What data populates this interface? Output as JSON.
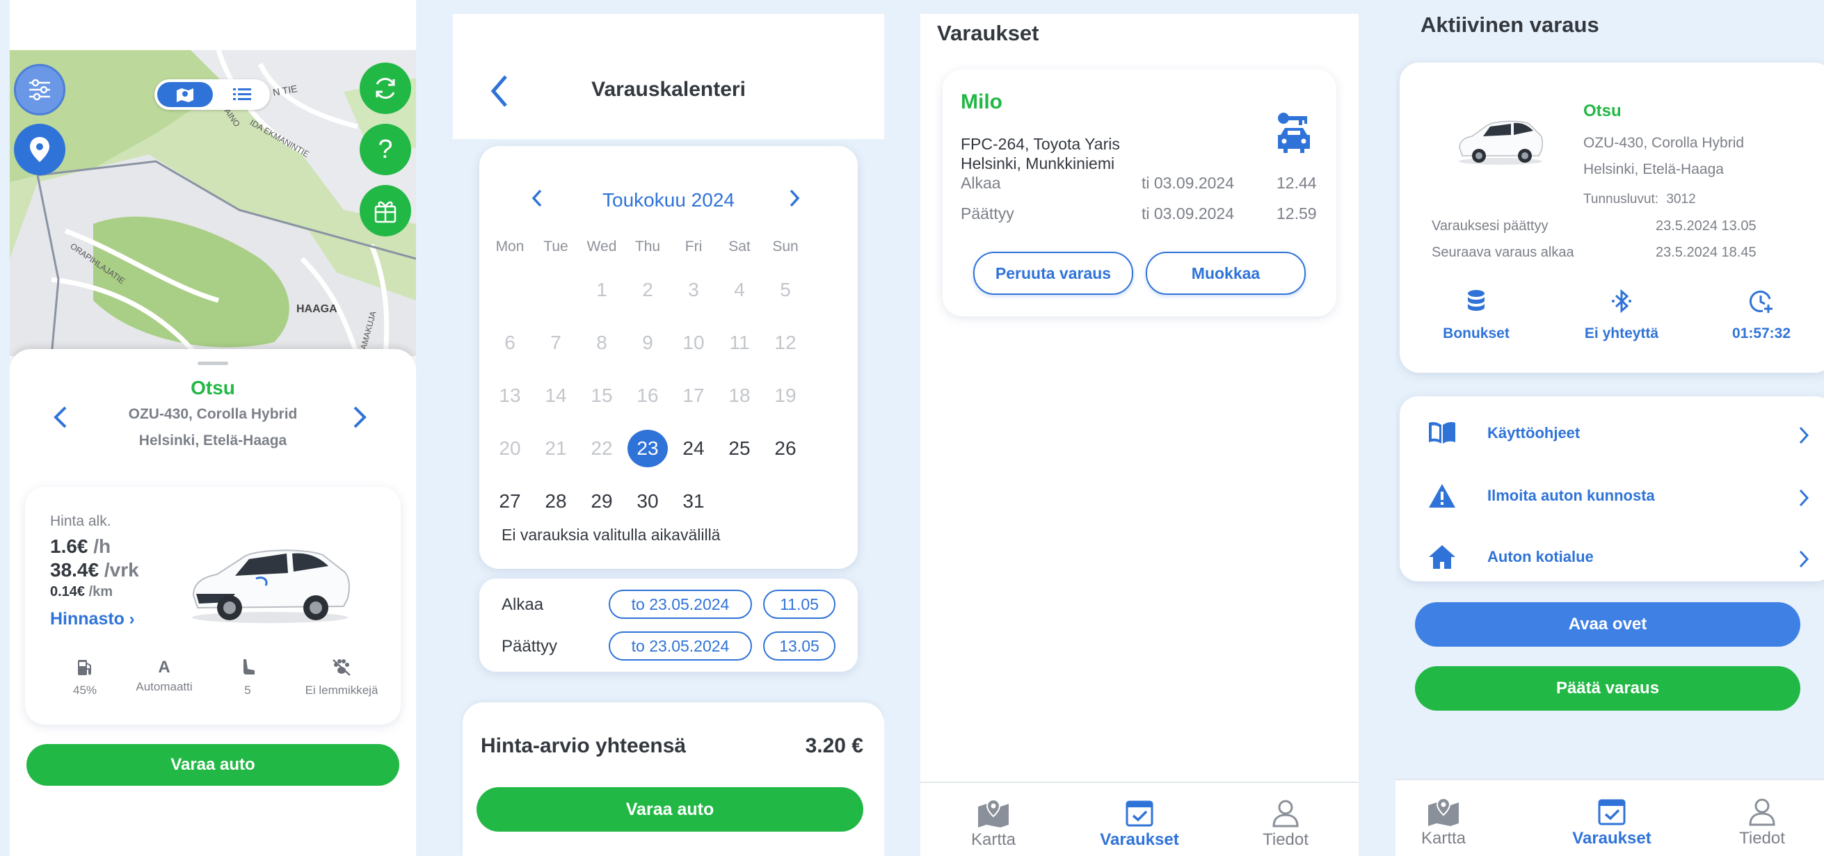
{
  "colors": {
    "primary": "#2f73d8",
    "green": "#22b845",
    "background": "#e7f1fb"
  },
  "screen1": {
    "map_labels": [
      "N TIE",
      "AINO",
      "IDA EKMANINTIE",
      "ORAPIHLAJATIE",
      "HAAGA",
      "KAMAKUJA"
    ],
    "car_name": "Otsu",
    "car_plate": "OZU-430, Corolla Hybrid",
    "car_location": "Helsinki, Etelä-Haaga",
    "price_label": "Hinta alk.",
    "price_hour": "1.6€",
    "price_hour_unit": "/h",
    "price_day": "38.4€",
    "price_day_unit": "/vrk",
    "price_km": "0.14€",
    "price_km_unit": "/km",
    "price_list_link": "Hinnasto",
    "features": [
      {
        "icon": "fuel-icon",
        "label": "45%"
      },
      {
        "icon": "transmission-icon",
        "glyph": "A",
        "label": "Automaatti"
      },
      {
        "icon": "seat-icon",
        "label": "5"
      },
      {
        "icon": "no-pets-icon",
        "label": "Ei lemmikkejä"
      }
    ],
    "book_button": "Varaa auto"
  },
  "screen2": {
    "title": "Varauskalenteri",
    "month": "Toukokuu 2024",
    "weekdays": [
      "Mon",
      "Tue",
      "Wed",
      "Thu",
      "Fri",
      "Sat",
      "Sun"
    ],
    "weeks": [
      [
        "",
        "",
        "1",
        "2",
        "3",
        "4",
        "5"
      ],
      [
        "6",
        "7",
        "8",
        "9",
        "10",
        "11",
        "12"
      ],
      [
        "13",
        "14",
        "15",
        "16",
        "17",
        "18",
        "19"
      ],
      [
        "20",
        "21",
        "22",
        "23",
        "24",
        "25",
        "26"
      ],
      [
        "27",
        "28",
        "29",
        "30",
        "31",
        "",
        ""
      ]
    ],
    "selected_day": "23",
    "no_bookings": "Ei varauksia valitulla aikavälillä",
    "start_label": "Alkaa",
    "start_date": "to 23.05.2024",
    "start_time": "11.05",
    "end_label": "Päättyy",
    "end_date": "to 23.05.2024",
    "end_time": "13.05",
    "total_label": "Hinta-arvio yhteensä",
    "total_value": "3.20 €",
    "book_button": "Varaa auto"
  },
  "screen3": {
    "title": "Varaukset",
    "car_name": "Milo",
    "car_info": "FPC-264, Toyota Yaris",
    "car_location": "Helsinki, Munkkiniemi",
    "start_label": "Alkaa",
    "start_date": "ti 03.09.2024",
    "start_time": "12.44",
    "end_label": "Päättyy",
    "end_date": "ti 03.09.2024",
    "end_time": "12.59",
    "cancel_button": "Peruuta varaus",
    "edit_button": "Muokkaa"
  },
  "screen4": {
    "title": "Aktiivinen varaus",
    "car_name": "Otsu",
    "car_plate": "OZU-430, Corolla Hybrid",
    "car_location": "Helsinki, Etelä-Haaga",
    "code_label": "Tunnusluvut:",
    "code_value": "3012",
    "ends_label": "Varauksesi päättyy",
    "ends_value": "23.5.2024 13.05",
    "next_label": "Seuraava varaus alkaa",
    "next_value": "23.5.2024 18.45",
    "bonus_label": "Bonukset",
    "bluetooth_label": "Ei yhteyttä",
    "timer_label": "01:57:32",
    "menu": [
      "Käyttöohjeet",
      "Ilmoita auton kunnosta",
      "Auton kotialue"
    ],
    "open_doors_button": "Avaa ovet",
    "end_booking_button": "Päätä varaus"
  },
  "nav": {
    "map": "Kartta",
    "bookings": "Varaukset",
    "info": "Tiedot"
  }
}
